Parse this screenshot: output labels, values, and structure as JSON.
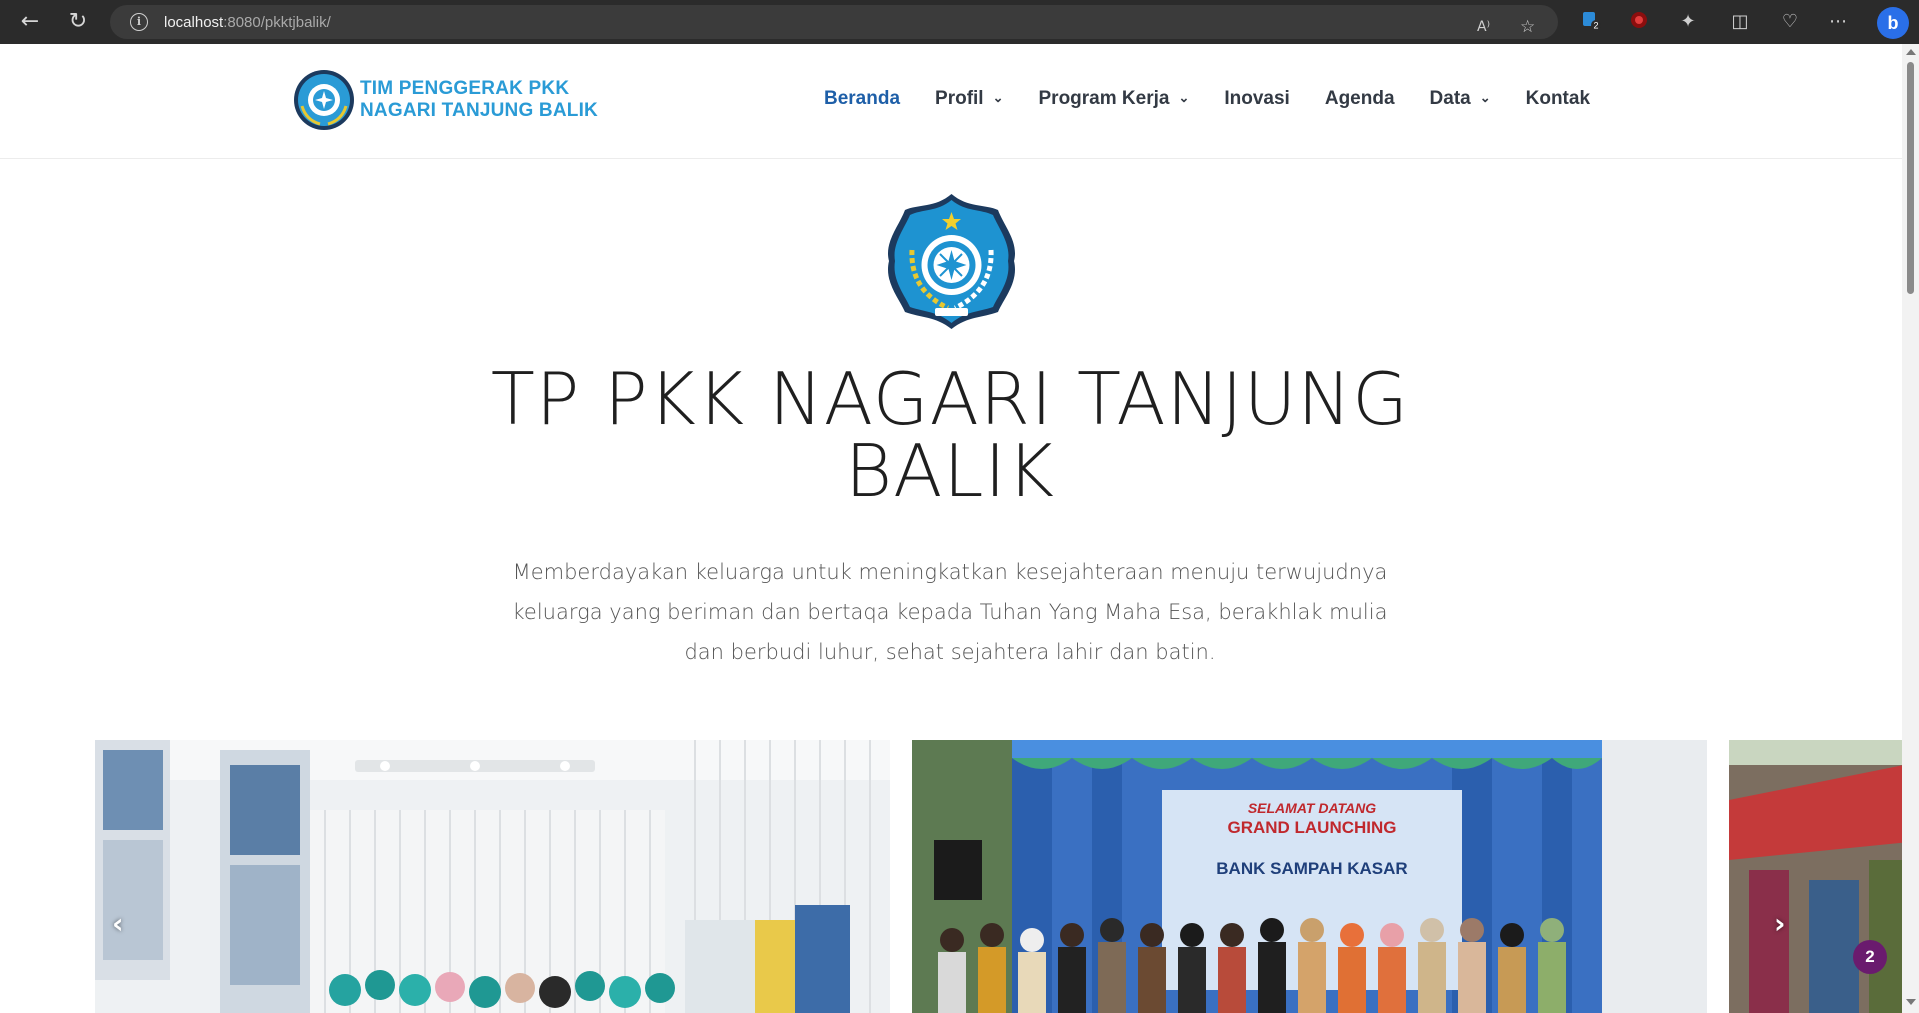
{
  "browser": {
    "url_host": "localhost",
    "url_rest": ":8080/pkktjbalik/",
    "extension_badge": "2"
  },
  "header": {
    "brand_line1": "TIM PENGGERAK PKK",
    "brand_line2": "NAGARI TANJUNG BALIK",
    "menu": [
      {
        "label": "Beranda",
        "dropdown": false,
        "active": true
      },
      {
        "label": "Profil",
        "dropdown": true,
        "active": false
      },
      {
        "label": "Program Kerja",
        "dropdown": true,
        "active": false
      },
      {
        "label": "Inovasi",
        "dropdown": false,
        "active": false
      },
      {
        "label": "Agenda",
        "dropdown": false,
        "active": false
      },
      {
        "label": "Data",
        "dropdown": true,
        "active": false
      },
      {
        "label": "Kontak",
        "dropdown": false,
        "active": false
      }
    ]
  },
  "hero": {
    "title_line1": "TP PKK NAGARI TANJUNG",
    "title_line2": "BALIK",
    "subtitle": "Memberdayakan keluarga untuk meningkatkan kesejahteraan menuju terwujudnya keluarga yang beriman dan bertaqa kepada Tuhan Yang Maha Esa, berakhlak mulia dan berbudi luhur, sehat sejahtera lahir dan batin."
  },
  "carousel": {
    "slide2_banner_line1": "SELAMAT DATANG",
    "slide2_banner_line2": "GRAND LAUNCHING",
    "slide2_banner_line3": "BANK SAMPAH KASAR",
    "floating_badge": "2"
  },
  "colors": {
    "accent": "#1e5fa8",
    "brand": "#2a9bd6",
    "logo_blue": "#1e93d1",
    "badge": "#6a1b6e"
  }
}
